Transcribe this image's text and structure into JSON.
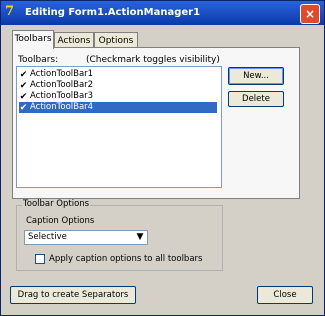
{
  "window": {
    "title": "Editing Form1.ActionManager1",
    "title_icon": "7",
    "close": "×"
  },
  "tabs": [
    {
      "label": "Toolbars"
    },
    {
      "label": "Actions"
    },
    {
      "label": "Options"
    }
  ],
  "toolbars_tab": {
    "label": "Toolbars:",
    "hint": "(Checkmark toggles visibility)",
    "items": [
      {
        "label": "ActionToolBar1",
        "checked": true
      },
      {
        "label": "ActionToolBar2",
        "checked": true
      },
      {
        "label": "ActionToolBar3",
        "checked": true
      },
      {
        "label": "ActionToolBar4",
        "checked": true
      }
    ],
    "new_button": "New...",
    "delete_button": "Delete"
  },
  "toolbar_options": {
    "group_title": "Toolbar Options",
    "caption_label": "Caption Options",
    "caption_value": "Selective",
    "apply_label": "Apply caption options to all toolbars"
  },
  "footer": {
    "drag_button": "Drag to create Separators",
    "close_button": "Close"
  },
  "colors": {
    "selection": "#316ac5",
    "titlebar": "#0a3aa8"
  }
}
